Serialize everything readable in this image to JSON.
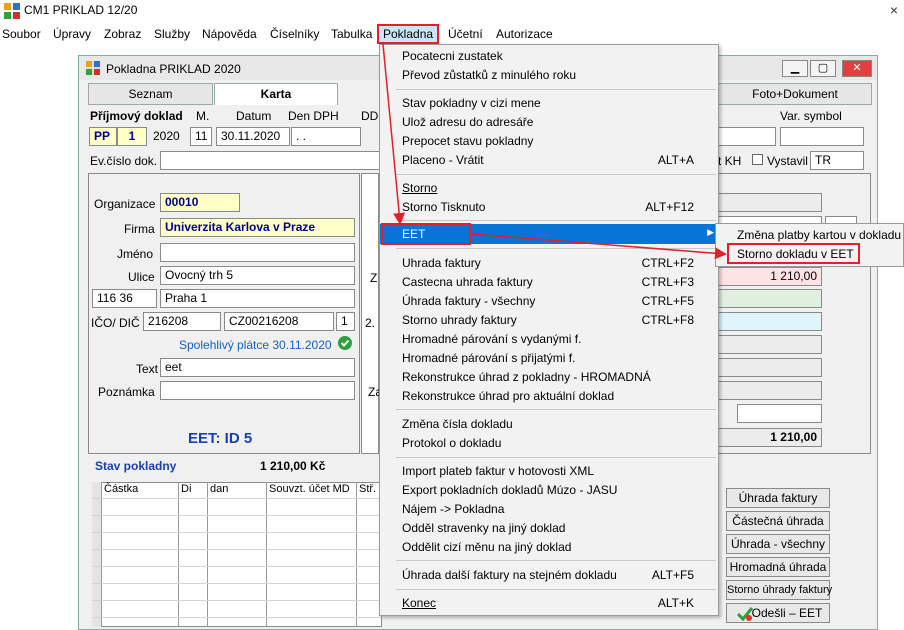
{
  "app": {
    "title": "CM1 PRIKLAD 12/20",
    "close": "×"
  },
  "menubar": [
    "Soubor",
    "Úpravy",
    "Zobraz",
    "Služby",
    "Nápověda",
    "Číselníky",
    "Tabulka",
    "Pokladna",
    "Účetní",
    "Autorizace"
  ],
  "window": {
    "title": "Pokladna PRIKLAD  2020",
    "minimize": "▁",
    "maximize": "▢",
    "close": "✕"
  },
  "tabs": [
    "Seznam",
    "Karta",
    "Foto+Dokument"
  ],
  "header": {
    "doc_type": "Příjmový doklad",
    "m_label": "M.",
    "datum_label": "Datum",
    "dendph_label": "Den DPH",
    "dd_label": "DD",
    "var_symbol_label": "Var. symbol",
    "series": "PP",
    "number": "1",
    "year": "2020",
    "month": "11",
    "date": "30.11.2020",
    "dph_date": " .  .",
    "evcislo_label": "Ev.číslo dok.",
    "kh_label": "t KH",
    "vystavil_label": "Vystavil",
    "vystavil": "TR"
  },
  "partner": {
    "organizace_label": "Organizace",
    "organizace": "00010",
    "firma_label": "Firma",
    "firma": "Univerzita Karlova v Praze",
    "jmeno_label": "Jméno",
    "jmeno": "",
    "ulice_label": "Ulice",
    "ulice": "Ovocný trh 5",
    "psc": "116 36",
    "mesto": "Praha 1",
    "ico_label": "IČO/ DIČ",
    "ico": "216208",
    "dic": "CZ00216208",
    "ico_suffix": "1",
    "spolehlivy": "Spolehlivý plátce 30.11.2020",
    "text_label": "Text",
    "text": "eet",
    "poznamka_label": "Poznámka",
    "poznamka": "",
    "eet_id": "EET: ID 5",
    "mid_label_2": "2.",
    "mid_label_z": "Z",
    "mid_label_za": "Za"
  },
  "right_panel": {
    "amount1": "1 210,00",
    "total": "1 210,00"
  },
  "stav": {
    "label": "Stav pokladny",
    "value": "1 210,00 Kč"
  },
  "grid": {
    "columns": [
      "Částka",
      "Di",
      "dan",
      "Souvzt. účet MD",
      "Stř."
    ]
  },
  "right_buttons": [
    "Úhrada faktury",
    "Částečná úhrada",
    "Úhrada - všechny",
    "Hromadná úhrada",
    "Storno úhrady faktury",
    "Odešli – EET"
  ],
  "dropdown": [
    {
      "label": "Pocatecni zustatek",
      "shortcut": ""
    },
    {
      "label": "Převod zůstatků z minulého roku",
      "shortcut": ""
    },
    {
      "label": "Stav pokladny v cizi mene",
      "shortcut": ""
    },
    {
      "label": "Ulož adresu do adresáře",
      "shortcut": ""
    },
    {
      "label": "Prepocet stavu pokladny",
      "shortcut": ""
    },
    {
      "label": "Placeno - Vrátit",
      "shortcut": "ALT+A"
    },
    {
      "label": "Storno",
      "shortcut": ""
    },
    {
      "label": "Storno Tisknuto",
      "shortcut": "ALT+F12"
    },
    {
      "label": "EET",
      "shortcut": "▶"
    },
    {
      "label": "Uhrada faktury",
      "shortcut": "CTRL+F2"
    },
    {
      "label": "Castecna uhrada faktury",
      "shortcut": "CTRL+F3"
    },
    {
      "label": "Úhrada faktury - všechny",
      "shortcut": "CTRL+F5"
    },
    {
      "label": "Storno uhrady faktury",
      "shortcut": "CTRL+F8"
    },
    {
      "label": "Hromadné párování s vydanými f.",
      "shortcut": ""
    },
    {
      "label": "Hromadné párování s přijatými f.",
      "shortcut": ""
    },
    {
      "label": "Rekonstrukce úhrad z pokladny - HROMADNÁ",
      "shortcut": ""
    },
    {
      "label": "Rekonstrukce úhrad pro aktuální doklad",
      "shortcut": ""
    },
    {
      "label": "Změna čísla dokladu",
      "shortcut": ""
    },
    {
      "label": "Protokol o dokladu",
      "shortcut": ""
    },
    {
      "label": "Import plateb faktur v hotovosti XML",
      "shortcut": ""
    },
    {
      "label": "Export pokladních dokladů Múzo - JASU",
      "shortcut": ""
    },
    {
      "label": "Nájem -> Pokladna",
      "shortcut": ""
    },
    {
      "label": "Odděl stravenky na jiný doklad",
      "shortcut": ""
    },
    {
      "label": "Oddělit cizí měnu na jiný doklad",
      "shortcut": ""
    },
    {
      "label": "Úhrada další faktury na stejném dokladu",
      "shortcut": "ALT+F5"
    },
    {
      "label": "Konec",
      "shortcut": "ALT+K"
    }
  ],
  "submenu": [
    "Změna platby kartou v dokladu",
    "Storno dokladu v EET"
  ],
  "colors": {
    "highlight": "#0a74d6",
    "annotation": "#e0202a",
    "firm_text": "#00008b"
  }
}
